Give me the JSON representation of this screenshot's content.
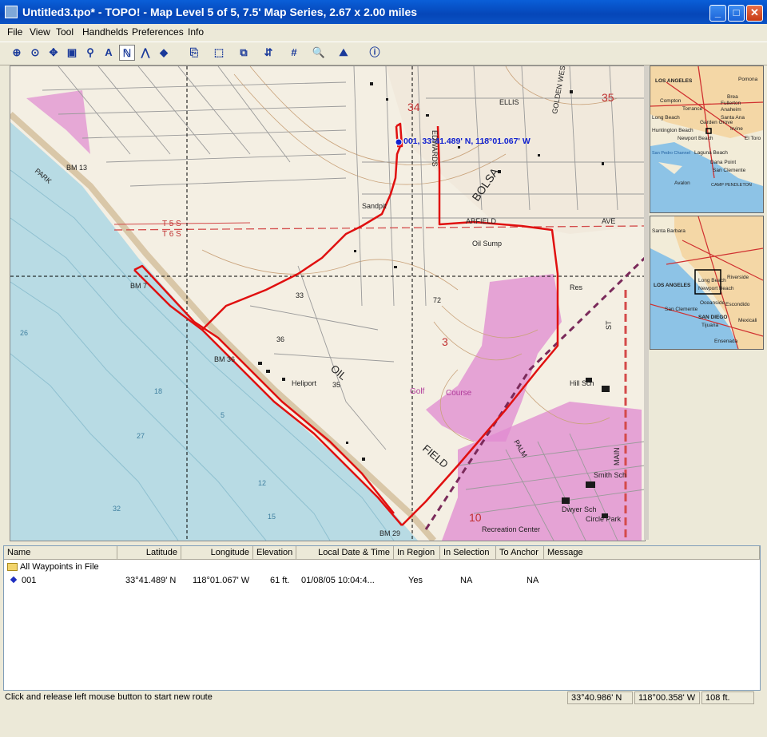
{
  "window": {
    "title": "Untitled3.tpo* - TOPO! - Map Level 5 of 5, 7.5' Map Series, 2.67 x 2.00 miles",
    "minimize": "_",
    "maximize": "□",
    "close": "✕"
  },
  "menu": [
    "File",
    "View",
    "Tool",
    "Handhelds",
    "Preferences",
    "Info"
  ],
  "toolbar": {
    "icons": [
      "zoom-in-icon",
      "center-icon",
      "pan-icon",
      "copy-icon",
      "pin-icon",
      "text-icon",
      "route-icon",
      "compass-icon",
      "waypoint-icon",
      "open-icon",
      "select-icon",
      "grid-align-icon",
      "gps-icon",
      "grid-icon",
      "zoom-icon",
      "profile-icon",
      "info-icon"
    ],
    "glyphs": [
      "⊕",
      "⊙",
      "✥",
      "▣",
      "⚲",
      "A",
      "ℕ",
      "⋀",
      "◆",
      "⎘",
      "⬚",
      "⧉",
      "⇵",
      "#",
      "🔍",
      "⛰",
      "ⓘ"
    ]
  },
  "map": {
    "waypoint_label": "001, 33°41.489' N, 118°01.067' W",
    "labels": [
      "BM 13",
      "PARK",
      "Sandpit",
      "T 5 S",
      "T 6 S",
      "BM 7",
      "Oil Sump",
      "Res",
      "BM 36",
      "Heliport",
      "OIL",
      "FIELD",
      "BOLSA",
      "Golf",
      "Course",
      "Hill Sch",
      "Smith Sch",
      "Dwyer Sch",
      "Recreation Center",
      "Circle Park",
      "BM 29",
      "ELLIS",
      "EDWARDS",
      "GOLDEN WEST",
      "ARFIELD",
      "AVE",
      "MAIN",
      "ST",
      "PALM",
      "35",
      "34",
      "3",
      "10",
      "33",
      "36",
      "35",
      "72",
      "26",
      "18",
      "27",
      "32",
      "15",
      "12",
      "5"
    ]
  },
  "overview_top": {
    "labels": [
      "LOS ANGELES",
      "Compton",
      "Long Beach",
      "Torrance",
      "Fullerton",
      "Anaheim",
      "Santa Ana",
      "Huntington Beach",
      "Newport Beach",
      "Laguna Beach",
      "Dana Point",
      "San Clemente",
      "CAMP PENDLETON",
      "Avalon",
      "San Pedro Channel",
      "Pomona",
      "Brea",
      "Irvine",
      "El Toro",
      "Garden Grove"
    ]
  },
  "overview_bottom": {
    "labels": [
      "LOS ANGELES",
      "Long Beach",
      "Newport Beach",
      "Santa Barbara",
      "Riverside",
      "SAN DIEGO",
      "Tijuana",
      "Ensenada",
      "Oceanside",
      "Escondido",
      "San Clemente",
      "Mexicali"
    ]
  },
  "waypoints": {
    "columns": [
      "Name",
      "Latitude",
      "Longitude",
      "Elevation",
      "Local Date & Time",
      "In Region",
      "In Selection",
      "To Anchor",
      "Message"
    ],
    "folder": "All Waypoints in File",
    "rows": [
      {
        "name": "001",
        "latitude": "33°41.489' N",
        "longitude": "118°01.067' W",
        "elevation": "61 ft.",
        "datetime": "01/08/05 10:04:4...",
        "in_region": "Yes",
        "in_selection": "NA",
        "to_anchor": "NA",
        "message": ""
      }
    ]
  },
  "status": {
    "message": "Click and release left mouse button to start new route",
    "latitude": "33°40.986' N",
    "longitude": "118°00.358' W",
    "elevation": "108 ft."
  },
  "colors": {
    "route": "#e01010",
    "water": "#b8dbe4",
    "land": "#f4efe3",
    "urban": "#e08ad0",
    "waypoint": "#1020d0"
  }
}
